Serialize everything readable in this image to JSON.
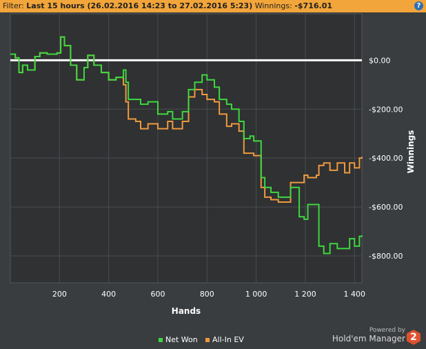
{
  "filter": {
    "label": "Filter:",
    "value": "Last 15 hours (26.02.2016 14:23 to 27.02.2016 5:23)",
    "winnings_label": "Winnings:",
    "winnings_value": "-$716.01"
  },
  "help_icon_glyph": "?",
  "brand": {
    "powered_by": "Powered by",
    "name": "Hold'em Manager",
    "logo_text": "2"
  },
  "colors": {
    "background": "#3a3d40",
    "plot_background": "#2f3133",
    "grid": "#4a4d50",
    "zero_line": "#ffffff",
    "net_won": "#3fd83f",
    "all_in_ev": "#f09a3e",
    "filter_bar": "#f2a53a"
  },
  "chart_data": {
    "type": "line",
    "xlabel": "Hands",
    "ylabel": "Winnings",
    "xlim": [
      0,
      1430
    ],
    "ylim": [
      -910,
      190
    ],
    "x_ticks": [
      200,
      400,
      600,
      800,
      1000,
      1200,
      1400
    ],
    "x_tick_labels": [
      "200",
      "400",
      "600",
      "800",
      "1 000",
      "1 200",
      "1 400"
    ],
    "y_ticks": [
      0,
      -200,
      -400,
      -600,
      -800
    ],
    "y_tick_labels": [
      "$0.00",
      "-$200.00",
      "-$400.00",
      "-$600.00",
      "-$800.00"
    ],
    "grid": true,
    "legend_position": "bottom",
    "series": [
      {
        "name": "Net Won",
        "color": "#3fd83f",
        "points": [
          [
            0,
            25
          ],
          [
            20,
            10
          ],
          [
            35,
            -50
          ],
          [
            50,
            -20
          ],
          [
            70,
            -40
          ],
          [
            100,
            15
          ],
          [
            120,
            30
          ],
          [
            150,
            25
          ],
          [
            190,
            30
          ],
          [
            205,
            95
          ],
          [
            220,
            60
          ],
          [
            245,
            -20
          ],
          [
            270,
            -80
          ],
          [
            300,
            -30
          ],
          [
            315,
            20
          ],
          [
            340,
            -20
          ],
          [
            370,
            -50
          ],
          [
            400,
            -80
          ],
          [
            430,
            -70
          ],
          [
            460,
            -40
          ],
          [
            470,
            -90
          ],
          [
            480,
            -160
          ],
          [
            510,
            -160
          ],
          [
            530,
            -180
          ],
          [
            560,
            -170
          ],
          [
            600,
            -220
          ],
          [
            640,
            -210
          ],
          [
            660,
            -240
          ],
          [
            700,
            -210
          ],
          [
            725,
            -120
          ],
          [
            750,
            -90
          ],
          [
            780,
            -60
          ],
          [
            800,
            -80
          ],
          [
            830,
            -110
          ],
          [
            850,
            -160
          ],
          [
            880,
            -180
          ],
          [
            900,
            -200
          ],
          [
            930,
            -250
          ],
          [
            950,
            -320
          ],
          [
            975,
            -310
          ],
          [
            990,
            -330
          ],
          [
            1020,
            -480
          ],
          [
            1035,
            -520
          ],
          [
            1060,
            -540
          ],
          [
            1090,
            -560
          ],
          [
            1115,
            -560
          ],
          [
            1140,
            -520
          ],
          [
            1160,
            -520
          ],
          [
            1175,
            -640
          ],
          [
            1195,
            -650
          ],
          [
            1210,
            -590
          ],
          [
            1245,
            -590
          ],
          [
            1255,
            -760
          ],
          [
            1275,
            -790
          ],
          [
            1300,
            -750
          ],
          [
            1330,
            -770
          ],
          [
            1360,
            -770
          ],
          [
            1380,
            -730
          ],
          [
            1400,
            -760
          ],
          [
            1420,
            -720
          ],
          [
            1430,
            -716
          ]
        ]
      },
      {
        "name": "All-In EV",
        "color": "#f09a3e",
        "points": [
          [
            0,
            25
          ],
          [
            20,
            10
          ],
          [
            35,
            -50
          ],
          [
            50,
            -20
          ],
          [
            70,
            -40
          ],
          [
            100,
            15
          ],
          [
            120,
            30
          ],
          [
            150,
            25
          ],
          [
            190,
            30
          ],
          [
            205,
            95
          ],
          [
            220,
            60
          ],
          [
            245,
            -20
          ],
          [
            270,
            -80
          ],
          [
            300,
            -30
          ],
          [
            315,
            20
          ],
          [
            340,
            -20
          ],
          [
            370,
            -50
          ],
          [
            400,
            -80
          ],
          [
            430,
            -70
          ],
          [
            460,
            -100
          ],
          [
            470,
            -170
          ],
          [
            480,
            -240
          ],
          [
            510,
            -250
          ],
          [
            530,
            -280
          ],
          [
            560,
            -260
          ],
          [
            600,
            -280
          ],
          [
            640,
            -250
          ],
          [
            660,
            -280
          ],
          [
            700,
            -250
          ],
          [
            725,
            -150
          ],
          [
            750,
            -120
          ],
          [
            780,
            -140
          ],
          [
            800,
            -160
          ],
          [
            830,
            -170
          ],
          [
            850,
            -220
          ],
          [
            880,
            -270
          ],
          [
            900,
            -260
          ],
          [
            930,
            -290
          ],
          [
            950,
            -380
          ],
          [
            975,
            -380
          ],
          [
            990,
            -390
          ],
          [
            1020,
            -520
          ],
          [
            1035,
            -560
          ],
          [
            1060,
            -570
          ],
          [
            1090,
            -580
          ],
          [
            1115,
            -580
          ],
          [
            1140,
            -500
          ],
          [
            1160,
            -500
          ],
          [
            1175,
            -500
          ],
          [
            1195,
            -470
          ],
          [
            1210,
            -480
          ],
          [
            1245,
            -470
          ],
          [
            1255,
            -430
          ],
          [
            1275,
            -420
          ],
          [
            1300,
            -450
          ],
          [
            1330,
            -420
          ],
          [
            1360,
            -460
          ],
          [
            1380,
            -420
          ],
          [
            1400,
            -440
          ],
          [
            1420,
            -400
          ],
          [
            1430,
            -395
          ]
        ]
      }
    ]
  }
}
